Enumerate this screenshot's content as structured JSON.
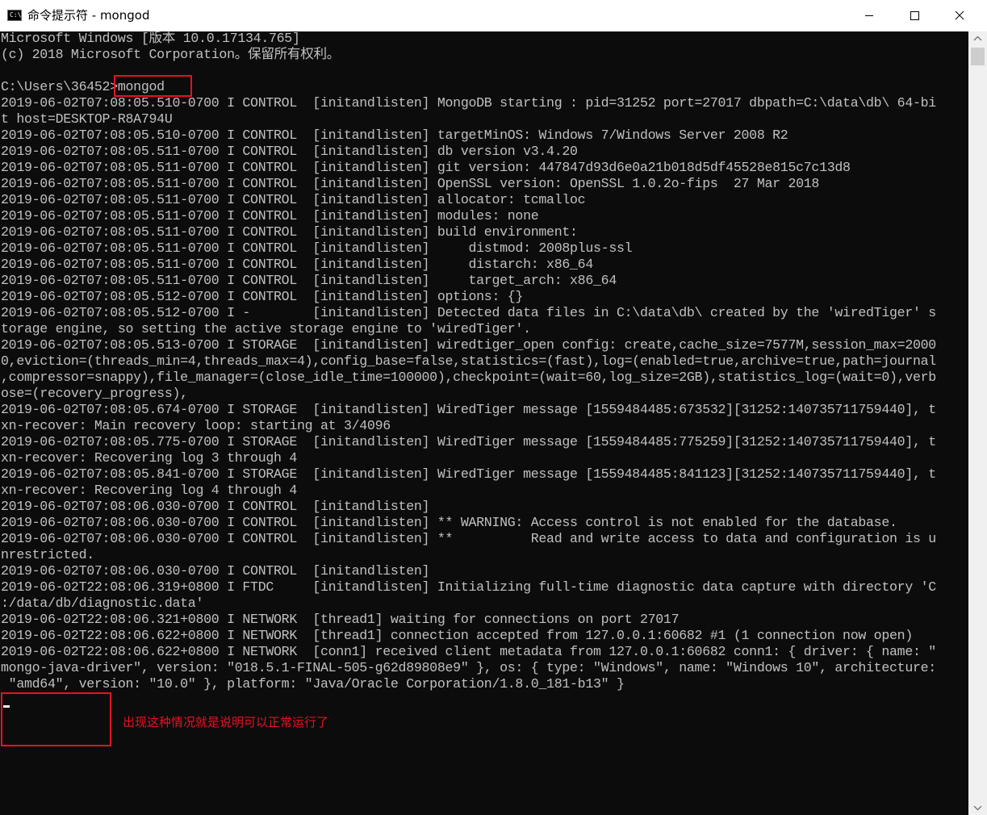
{
  "window": {
    "title": "命令提示符 - mongod",
    "icon": "cmd-icon",
    "icon_text": "C:\\"
  },
  "controls": {
    "minimize": "minimize-icon",
    "maximize": "maximize-icon",
    "close": "close-icon"
  },
  "console": {
    "lines": [
      "Microsoft Windows [版本 10.0.17134.765]",
      "(c) 2018 Microsoft Corporation。保留所有权利。",
      "",
      "C:\\Users\\36452>mongod",
      "2019-06-02T07:08:05.510-0700 I CONTROL  [initandlisten] MongoDB starting : pid=31252 port=27017 dbpath=C:\\data\\db\\ 64-bi",
      "t host=DESKTOP-R8A794U",
      "2019-06-02T07:08:05.510-0700 I CONTROL  [initandlisten] targetMinOS: Windows 7/Windows Server 2008 R2",
      "2019-06-02T07:08:05.511-0700 I CONTROL  [initandlisten] db version v3.4.20",
      "2019-06-02T07:08:05.511-0700 I CONTROL  [initandlisten] git version: 447847d93d6e0a21b018d5df45528e815c7c13d8",
      "2019-06-02T07:08:05.511-0700 I CONTROL  [initandlisten] OpenSSL version: OpenSSL 1.0.2o-fips  27 Mar 2018",
      "2019-06-02T07:08:05.511-0700 I CONTROL  [initandlisten] allocator: tcmalloc",
      "2019-06-02T07:08:05.511-0700 I CONTROL  [initandlisten] modules: none",
      "2019-06-02T07:08:05.511-0700 I CONTROL  [initandlisten] build environment:",
      "2019-06-02T07:08:05.511-0700 I CONTROL  [initandlisten]     distmod: 2008plus-ssl",
      "2019-06-02T07:08:05.511-0700 I CONTROL  [initandlisten]     distarch: x86_64",
      "2019-06-02T07:08:05.511-0700 I CONTROL  [initandlisten]     target_arch: x86_64",
      "2019-06-02T07:08:05.512-0700 I CONTROL  [initandlisten] options: {}",
      "2019-06-02T07:08:05.512-0700 I -        [initandlisten] Detected data files in C:\\data\\db\\ created by the 'wiredTiger' s",
      "torage engine, so setting the active storage engine to 'wiredTiger'.",
      "2019-06-02T07:08:05.513-0700 I STORAGE  [initandlisten] wiredtiger_open config: create,cache_size=7577M,session_max=2000",
      "0,eviction=(threads_min=4,threads_max=4),config_base=false,statistics=(fast),log=(enabled=true,archive=true,path=journal",
      ",compressor=snappy),file_manager=(close_idle_time=100000),checkpoint=(wait=60,log_size=2GB),statistics_log=(wait=0),verb",
      "ose=(recovery_progress),",
      "2019-06-02T07:08:05.674-0700 I STORAGE  [initandlisten] WiredTiger message [1559484485:673532][31252:140735711759440], t",
      "xn-recover: Main recovery loop: starting at 3/4096",
      "2019-06-02T07:08:05.775-0700 I STORAGE  [initandlisten] WiredTiger message [1559484485:775259][31252:140735711759440], t",
      "xn-recover: Recovering log 3 through 4",
      "2019-06-02T07:08:05.841-0700 I STORAGE  [initandlisten] WiredTiger message [1559484485:841123][31252:140735711759440], t",
      "xn-recover: Recovering log 4 through 4",
      "2019-06-02T07:08:06.030-0700 I CONTROL  [initandlisten]",
      "2019-06-02T07:08:06.030-0700 I CONTROL  [initandlisten] ** WARNING: Access control is not enabled for the database.",
      "2019-06-02T07:08:06.030-0700 I CONTROL  [initandlisten] **          Read and write access to data and configuration is u",
      "nrestricted.",
      "2019-06-02T07:08:06.030-0700 I CONTROL  [initandlisten]",
      "2019-06-02T22:08:06.319+0800 I FTDC     [initandlisten] Initializing full-time diagnostic data capture with directory 'C",
      ":/data/db/diagnostic.data'",
      "2019-06-02T22:08:06.321+0800 I NETWORK  [thread1] waiting for connections on port 27017",
      "2019-06-02T22:08:06.622+0800 I NETWORK  [thread1] connection accepted from 127.0.0.1:60682 #1 (1 connection now open)",
      "2019-06-02T22:08:06.622+0800 I NETWORK  [conn1] received client metadata from 127.0.0.1:60682 conn1: { driver: { name: \"",
      "mongo-java-driver\", version: \"018.5.1-FINAL-505-g62d89808e9\" }, os: { type: \"Windows\", name: \"Windows 10\", architecture:",
      " \"amd64\", version: \"10.0\" }, platform: \"Java/Oracle Corporation/1.8.0_181-b13\" }"
    ]
  },
  "annotation": {
    "text": "出现这种情况就是说明可以正常运行了",
    "color": "#e81123"
  },
  "colors": {
    "console_bg": "#0c0c0c",
    "console_fg": "#c0c0c0",
    "highlight": "#e81123"
  }
}
